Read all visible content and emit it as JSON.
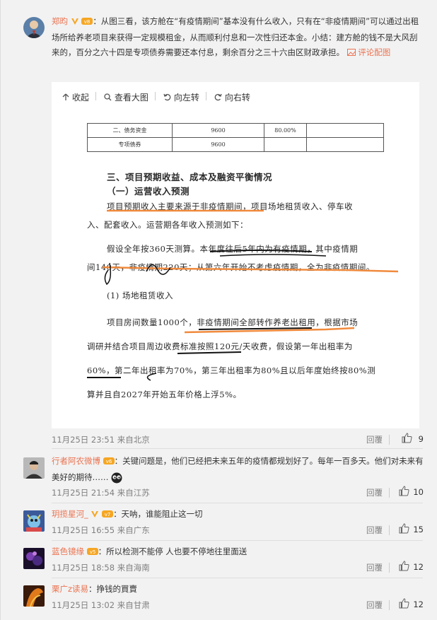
{
  "comments": [
    {
      "username": "郑昀",
      "text": "：从图三看，该方舱在“有疫情期间”基本没有什么收入，只有在“非疫情期间”可以通过出租场所给养老项目来获得一定规模租金，从而顺利付息和一次性归还本金。小结：建方舱的钱不是大风刮来的，百分之六十四是专项债券需要还本付息，剩余百分之三十六由区财政承担。",
      "image_link": "评论配图",
      "time": "11月25日 23:51 来自北京",
      "reply": "回覆",
      "likes": "9"
    },
    {
      "username": "行者阿农微博",
      "text": "：关键问题是，他们已经把未来五年的疫情都规划好了。每年一百多天。他们对未来有美好的期待……",
      "time": "11月25日 21:54 来自江苏",
      "reply": "回覆",
      "likes": "10"
    },
    {
      "username": "玥揽星河_",
      "text": "：天呐，谁能阻止这一切",
      "time": "11月25日 16:55 来自广东",
      "reply": "回覆",
      "likes": "15"
    },
    {
      "username": "蓝色镜缘",
      "text": "：所以检测不能停 人也要不停地往里面送",
      "time": "11月25日 18:58 来自海南",
      "reply": "回覆",
      "likes": "12"
    },
    {
      "username": "栗广z读易",
      "text": "：挣钱的買賣",
      "time": "11月25日 13:02 来自甘肃",
      "reply": "回覆",
      "likes": "12"
    }
  ],
  "image_toolbar": {
    "collapse": "收起",
    "view_large": "查看大图",
    "rotate_left": "向左转",
    "rotate_right": "向右转"
  },
  "document": {
    "table_rows": [
      [
        "二、债务资金",
        "9600",
        "80.00%",
        ""
      ],
      [
        "专项债券",
        "9600",
        "",
        ""
      ]
    ],
    "heading": "三、项目预期收益、成本及融资平衡情况",
    "subheading": "（一）运营收入预测",
    "para1_a": "项目预期收入主要来源于非疫情期间，项目场地租赁收入、停车收",
    "para1_b": "入、配套收入。运营期各年收入预测如下：",
    "para2_a": "假设全年按360天测算。本年度往后5年内为有疫情期，其中疫情期",
    "para2_b": "间140天，非疫情期220天；从第六年开始不考虑疫情期，全为非疫情期间。",
    "item1": "(1) 场地租赁收入",
    "para3_a": "项目房间数量1000个，非疫情期间全部转作养老出租用，根据市场",
    "para3_b": "调研并结合项目周边收费标准按照120元/天收费，假设第一年出租率为",
    "para3_c": "60%，第二年出租率为70%，第三年出租率为80%且以后年度始终按80%测",
    "para3_d": "算并且自2027年开始五年价格上浮5%。"
  },
  "colors": {
    "username": "#eb7350",
    "underline": "#f08a3c"
  }
}
